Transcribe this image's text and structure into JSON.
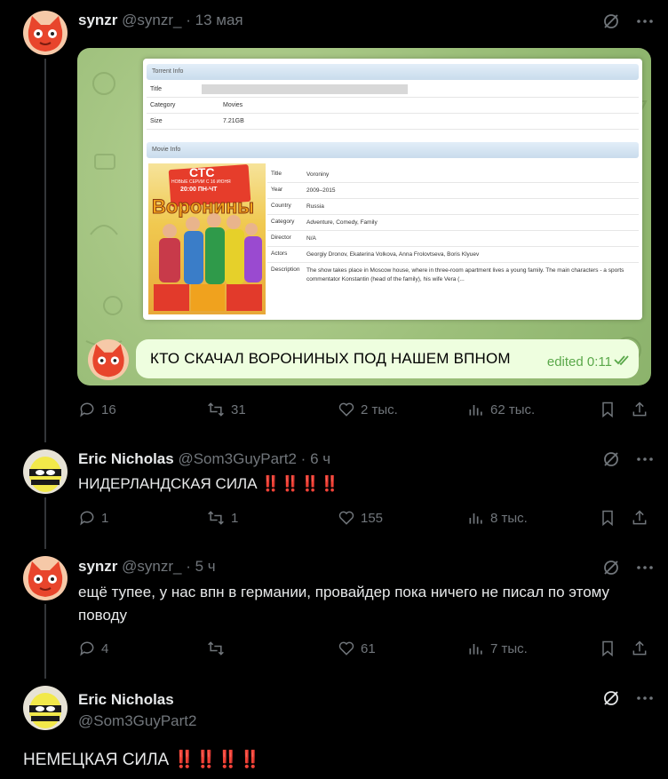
{
  "posts": [
    {
      "name": "synzr",
      "handle": "@synzr_",
      "sep": "·",
      "time": "13 мая",
      "media": {
        "torrent_header": "Torrent Info",
        "torrent_rows": [
          {
            "k": "Title",
            "v": ""
          },
          {
            "k": "Category",
            "v": "Movies"
          },
          {
            "k": "Size",
            "v": "7.21GB"
          }
        ],
        "movie_header": "Movie Info",
        "movie_rows": [
          {
            "k": "Title",
            "v": "Voroniny"
          },
          {
            "k": "Year",
            "v": "2009–2015"
          },
          {
            "k": "Country",
            "v": "Russia"
          },
          {
            "k": "Category",
            "v": "Adventure, Comedy, Family"
          },
          {
            "k": "Director",
            "v": "N/A"
          },
          {
            "k": "Actors",
            "v": "Georgiy Dronov, Ekaterina Volkova, Anna Frolovtseva, Boris Klyuev"
          },
          {
            "k": "Description",
            "v": "The show takes place in Moscow house, where in three-room apartment lives a young family. The main characters - a sports commentator Konstantin (head of the family), his wife Vera (..."
          }
        ],
        "poster_logo": "СТС",
        "poster_text1": "НОВЫЕ СЕРИИ С 16 ИЮНЯ",
        "poster_text2": "20:00 ПН-ЧТ",
        "poster_title": "Воронины",
        "chat_message": "КТО СКАЧАЛ ВОРОНИНЫХ ПОД НАШЕМ ВПНОМ",
        "chat_status": "edited 0:11"
      },
      "replies": "16",
      "reposts": "31",
      "likes": "2 тыс.",
      "views": "62 тыс."
    },
    {
      "name": "Eric Nicholas",
      "handle": "@Som3GuyPart2",
      "sep": "·",
      "time": "6 ч",
      "text": "НИДЕРЛАНДСКАЯ СИЛА",
      "bangs": "‼️‼️‼️‼️",
      "replies": "1",
      "reposts": "1",
      "likes": "155",
      "views": "8 тыс."
    },
    {
      "name": "synzr",
      "handle": "@synzr_",
      "sep": "·",
      "time": "5 ч",
      "text": "ещё тупее, у нас впн в германии, провайдер пока ничего не писал по этому поводу",
      "replies": "4",
      "reposts": "",
      "likes": "61",
      "views": "7 тыс."
    },
    {
      "name": "Eric Nicholas",
      "handle": "@Som3GuyPart2",
      "text": "НЕМЕЦКАЯ СИЛА",
      "bangs": "‼️‼️‼️‼️"
    }
  ],
  "colors": {
    "background": "#000000",
    "text": "#e7e9ea",
    "muted": "#71767b",
    "bangs": "#d0202a"
  }
}
